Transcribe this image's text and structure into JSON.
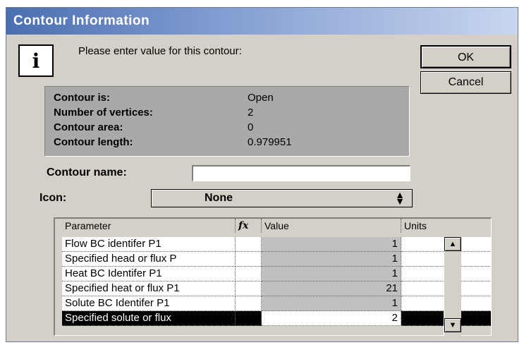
{
  "window": {
    "title": "Contour Information"
  },
  "dialog": {
    "prompt": "Please enter value for this contour:",
    "info_icon_glyph": "i",
    "ok_label": "OK",
    "cancel_label": "Cancel"
  },
  "info": [
    {
      "label": "Contour is:",
      "value": "Open"
    },
    {
      "label": "Number of vertices:",
      "value": "2"
    },
    {
      "label": "Contour area:",
      "value": "0"
    },
    {
      "label": "Contour length:",
      "value": "0.979951"
    }
  ],
  "form": {
    "name_label": "Contour name:",
    "name_value": "",
    "icon_label": "Icon:",
    "icon_value": "None"
  },
  "grid": {
    "headers": {
      "parameter": "Parameter",
      "fx": "fx",
      "value": "Value",
      "units": "Units"
    },
    "rows": [
      {
        "parameter": "Flow BC identifer P1",
        "value": "1",
        "units": "",
        "selected": false
      },
      {
        "parameter": "Specified head or flux P",
        "value": "1",
        "units": "",
        "selected": false
      },
      {
        "parameter": "Heat BC Identifer P1",
        "value": "1",
        "units": "",
        "selected": false
      },
      {
        "parameter": "Specified heat or flux P1",
        "value": "21",
        "units": "",
        "selected": false
      },
      {
        "parameter": "Solute BC Identifer P1",
        "value": "1",
        "units": "",
        "selected": false
      },
      {
        "parameter": "Specified solute or flux",
        "value": "2",
        "units": "",
        "selected": true
      }
    ]
  },
  "icons": {
    "info": "info-icon",
    "select_arrows": "updown-arrows-icon",
    "scroll_up": "scroll-up-arrow-icon",
    "scroll_down": "scroll-down-arrow-icon"
  },
  "colors": {
    "title_start": "#4a6fb0",
    "dialog_bg": "#d4d0c8",
    "info_panel": "#a9a9a9",
    "selection": "#000000"
  }
}
